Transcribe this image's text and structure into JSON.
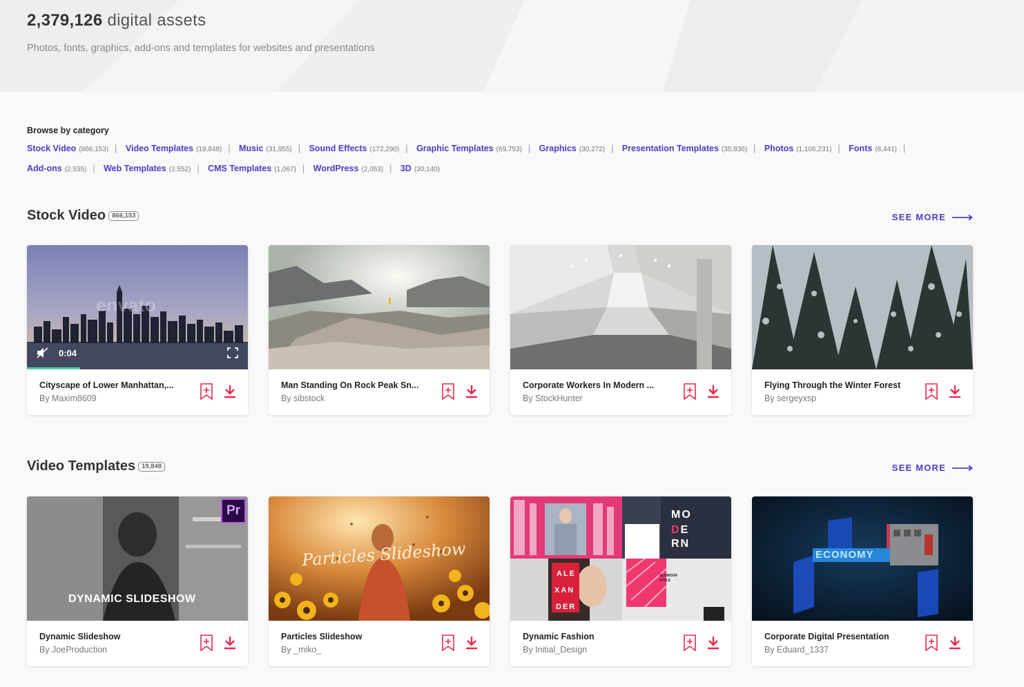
{
  "hero": {
    "count": "2,379,126",
    "count_suffix": "digital assets",
    "subtitle": "Photos, fonts, graphics, add-ons and templates for websites and presentations"
  },
  "browse": {
    "label": "Browse by category",
    "categories": [
      {
        "label": "Stock Video",
        "count": "(866,153)"
      },
      {
        "label": "Video Templates",
        "count": "(19,848)"
      },
      {
        "label": "Music",
        "count": "(31,955)"
      },
      {
        "label": "Sound Effects",
        "count": "(172,290)"
      },
      {
        "label": "Graphic Templates",
        "count": "(69,753)"
      },
      {
        "label": "Graphics",
        "count": "(30,272)"
      },
      {
        "label": "Presentation Templates",
        "count": "(35,836)"
      },
      {
        "label": "Photos",
        "count": "(1,106,231)"
      },
      {
        "label": "Fonts",
        "count": "(8,441)"
      },
      {
        "label": "Add-ons",
        "count": "(2,535)"
      },
      {
        "label": "Web Templates",
        "count": "(2,552)"
      },
      {
        "label": "CMS Templates",
        "count": "(1,067)"
      },
      {
        "label": "WordPress",
        "count": "(2,053)"
      },
      {
        "label": "3D",
        "count": "(30,140)"
      }
    ]
  },
  "sections": [
    {
      "title": "Stock Video",
      "badge": "866,153",
      "see_more": "SEE MORE",
      "items": [
        {
          "title": "Cityscape of Lower Manhattan,...",
          "author": "By Maxim8609",
          "time": "0:04",
          "watermark": "envato",
          "progress": 0.24
        },
        {
          "title": "Man Standing On Rock Peak Sn...",
          "author": "By sibstock"
        },
        {
          "title": "Corporate Workers In Modern ...",
          "author": "By StockHunter"
        },
        {
          "title": "Flying Through the Winter Forest",
          "author": "By sergeyxsp"
        }
      ]
    },
    {
      "title": "Video Templates",
      "badge": "19,848",
      "see_more": "SEE MORE",
      "items": [
        {
          "title": "Dynamic Slideshow",
          "author": "By JoeProduction",
          "thumb_text": "DYNAMIC SLIDESHOW",
          "app_badge": "Pr"
        },
        {
          "title": "Particles Slideshow",
          "author": "By _miko_",
          "thumb_text": "Particles Slideshow"
        },
        {
          "title": "Dynamic Fashion",
          "author": "By Initial_Design",
          "thumb_text_1": "MO",
          "thumb_text_2": "DE",
          "thumb_text_3": "RN",
          "thumb_text_4": "ALE",
          "thumb_text_5": "XAN",
          "thumb_text_6": "DER",
          "thumb_text_7": "GLAMOUR STYLE"
        },
        {
          "title": "Corporate Digital Presentation",
          "author": "By Eduard_1337",
          "thumb_text": "ECONOMY"
        }
      ]
    }
  ],
  "colors": {
    "link": "#4a3ec4",
    "accent": "#e8294c",
    "progress": "#4bd1a0"
  },
  "icons": {
    "bookmark": "bookmark-add-icon",
    "download": "download-icon",
    "mute": "muted-speaker-icon",
    "fullscreen": "fullscreen-icon",
    "arrow": "long-arrow-right-icon"
  }
}
